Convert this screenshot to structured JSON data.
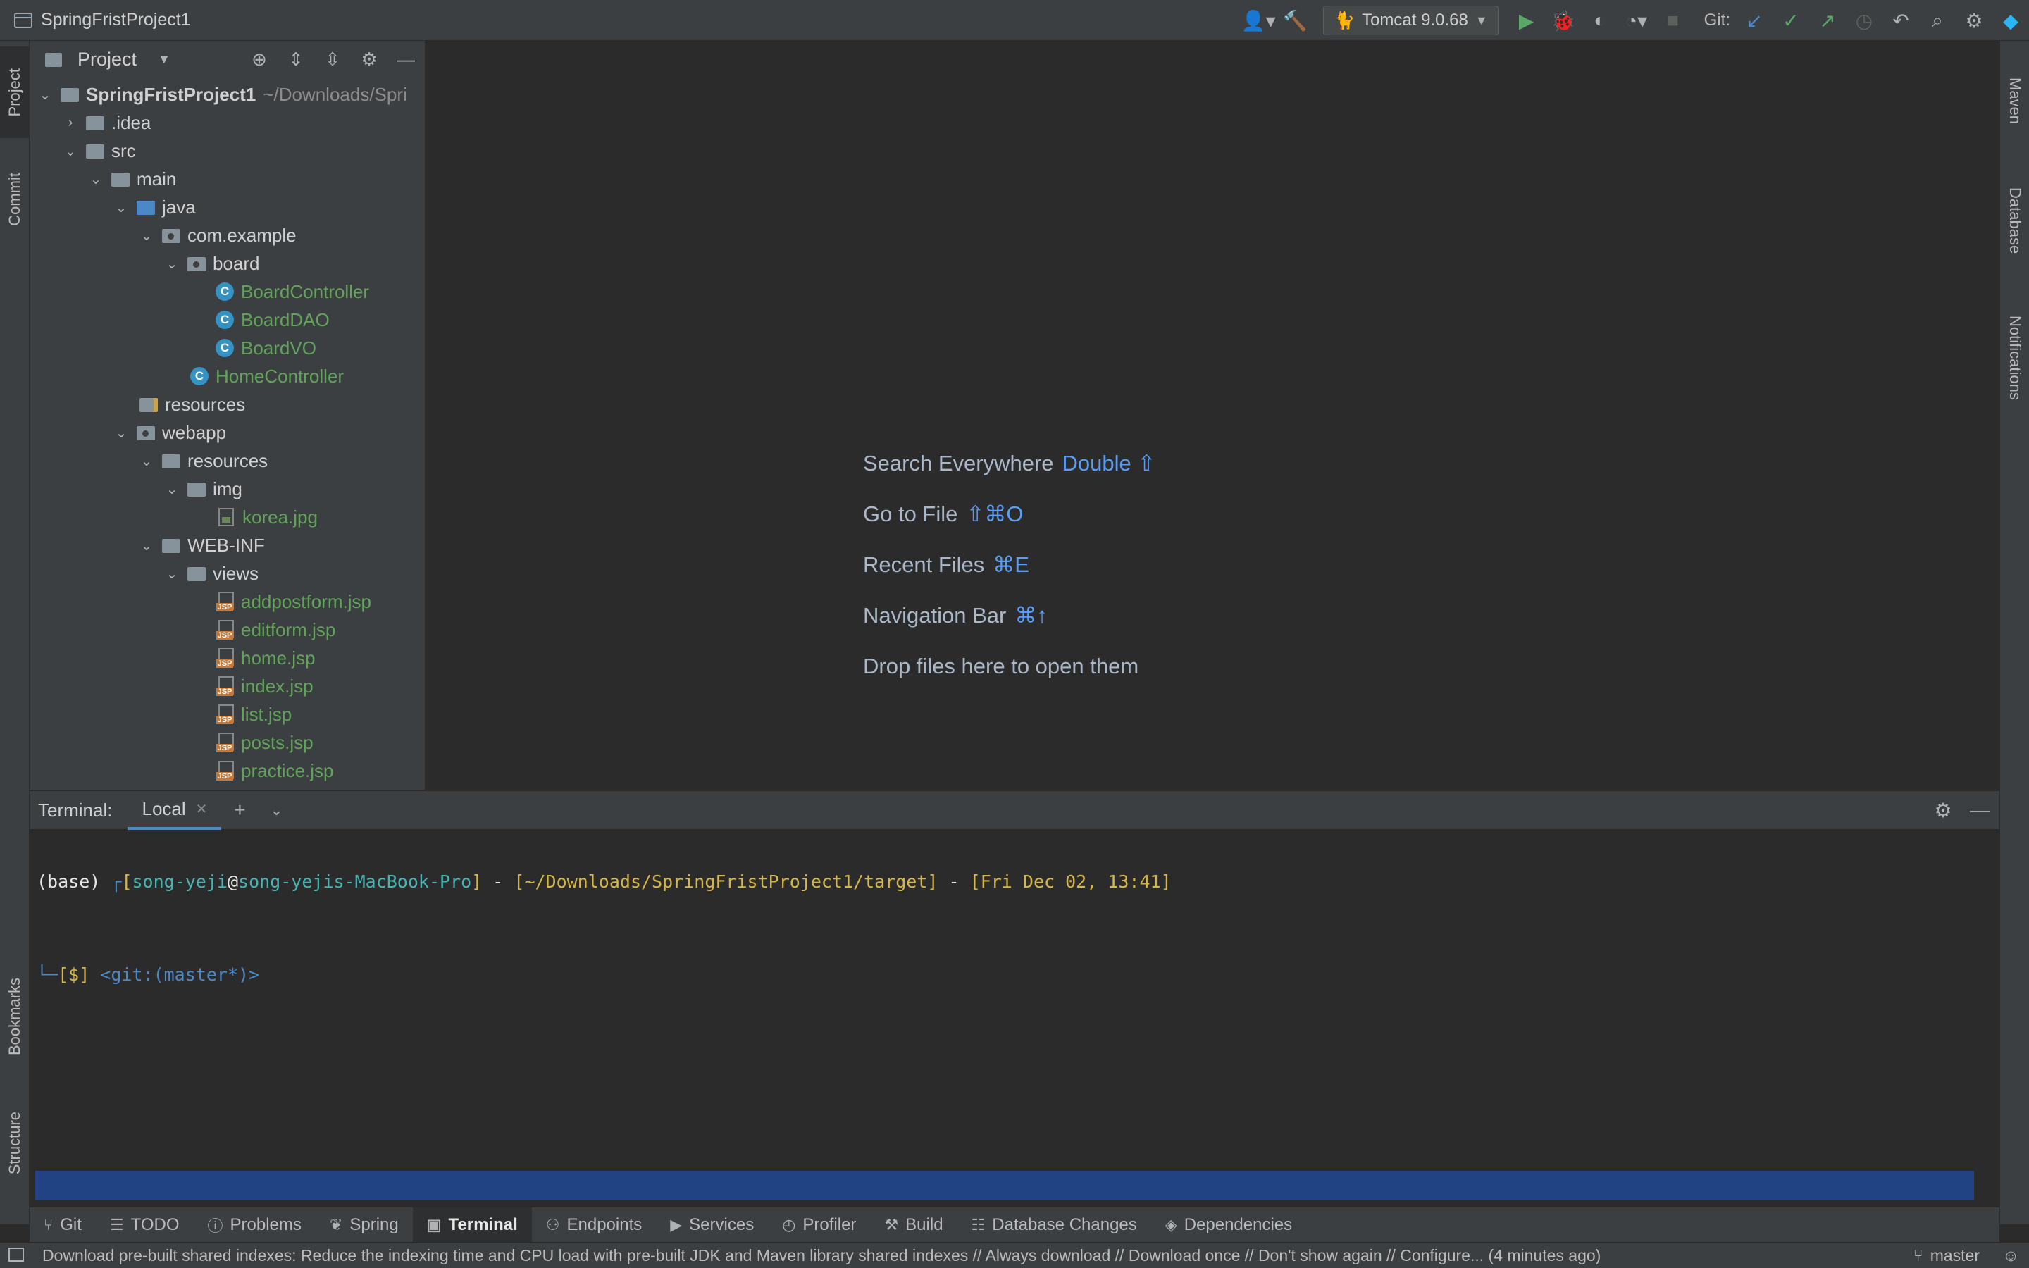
{
  "titlebar": {
    "project_name": "SpringFristProject1",
    "run_config": "Tomcat 9.0.68",
    "git_label": "Git:"
  },
  "left_strip": {
    "project_tab": "Project",
    "commit_tab": "Commit",
    "bookmarks_tab": "Bookmarks",
    "structure_tab": "Structure"
  },
  "right_strip": {
    "maven_tab": "Maven",
    "database_tab": "Database",
    "notifications_tab": "Notifications"
  },
  "project_panel": {
    "title": "Project",
    "root_name": "SpringFristProject1",
    "root_path": "~/Downloads/Spri",
    "tree": [
      {
        "label": "SpringFristProject1",
        "level": 0
      },
      {
        "label": ".idea",
        "level": 1
      },
      {
        "label": "src",
        "level": 1
      },
      {
        "label": "main",
        "level": 2
      },
      {
        "label": "java",
        "level": 3
      },
      {
        "label": "com.example",
        "level": 4
      },
      {
        "label": "board",
        "level": 5
      },
      {
        "label": "BoardController",
        "level": 6
      },
      {
        "label": "BoardDAO",
        "level": 6
      },
      {
        "label": "BoardVO",
        "level": 6
      },
      {
        "label": "HomeController",
        "level": 5
      },
      {
        "label": "resources",
        "level": 3
      },
      {
        "label": "webapp",
        "level": 3
      },
      {
        "label": "resources",
        "level": 4
      },
      {
        "label": "img",
        "level": 5
      },
      {
        "label": "korea.jpg",
        "level": 6
      },
      {
        "label": "WEB-INF",
        "level": 4
      },
      {
        "label": "views",
        "level": 5
      },
      {
        "label": "addpostform.jsp",
        "level": 6
      },
      {
        "label": "editform.jsp",
        "level": 6
      },
      {
        "label": "home.jsp",
        "level": 6
      },
      {
        "label": "index.jsp",
        "level": 6
      },
      {
        "label": "list.jsp",
        "level": 6
      },
      {
        "label": "posts.jsp",
        "level": 6
      },
      {
        "label": "practice.jsp",
        "level": 6
      }
    ]
  },
  "editor_hints": {
    "search_label": "Search Everywhere",
    "search_key": "Double ⇧",
    "goto_label": "Go to File",
    "goto_key": "⇧⌘O",
    "recent_label": "Recent Files",
    "recent_key": "⌘E",
    "nav_label": "Navigation Bar",
    "nav_key": "⌘↑",
    "drop_label": "Drop files here to open them"
  },
  "terminal": {
    "title": "Terminal:",
    "tab_label": "Local",
    "line1": {
      "base": "(base)",
      "corner": "┌",
      "bracket_open": "[",
      "user": "song-yeji",
      "at": "@",
      "host": "song-yejis-MacBook-Pro",
      "bracket_close": "]",
      "sep1": " - ",
      "path_open": "[",
      "path": "~/Downloads/SpringFristProject1/target",
      "path_close": "]",
      "sep2": " - ",
      "time_open": "[",
      "time": "Fri Dec 02, 13:41",
      "time_close": "]"
    },
    "line2": {
      "corner": "└─",
      "prompt": "[$]",
      "git": "<git:(master*)>"
    }
  },
  "bottom_bar": [
    {
      "label": "Git",
      "icon": "branch-icon"
    },
    {
      "label": "TODO",
      "icon": "list-icon"
    },
    {
      "label": "Problems",
      "icon": "info-icon"
    },
    {
      "label": "Spring",
      "icon": "leaf-icon"
    },
    {
      "label": "Terminal",
      "icon": "terminal-icon"
    },
    {
      "label": "Endpoints",
      "icon": "endpoints-icon"
    },
    {
      "label": "Services",
      "icon": "services-icon"
    },
    {
      "label": "Profiler",
      "icon": "profiler-icon"
    },
    {
      "label": "Build",
      "icon": "hammer-icon"
    },
    {
      "label": "Database Changes",
      "icon": "database-changes-icon"
    },
    {
      "label": "Dependencies",
      "icon": "dependencies-icon"
    }
  ],
  "status_bar": {
    "message": "Download pre-built shared indexes: Reduce the indexing time and CPU load with pre-built JDK and Maven library shared indexes // Always download // Download once // Don't show again // Configure... (4 minutes ago)",
    "branch": "master"
  },
  "colors": {
    "accent": "#4A88C7",
    "editor_bg": "#2B2B2B",
    "panel_bg": "#3C3F41",
    "selection": "#214283"
  }
}
